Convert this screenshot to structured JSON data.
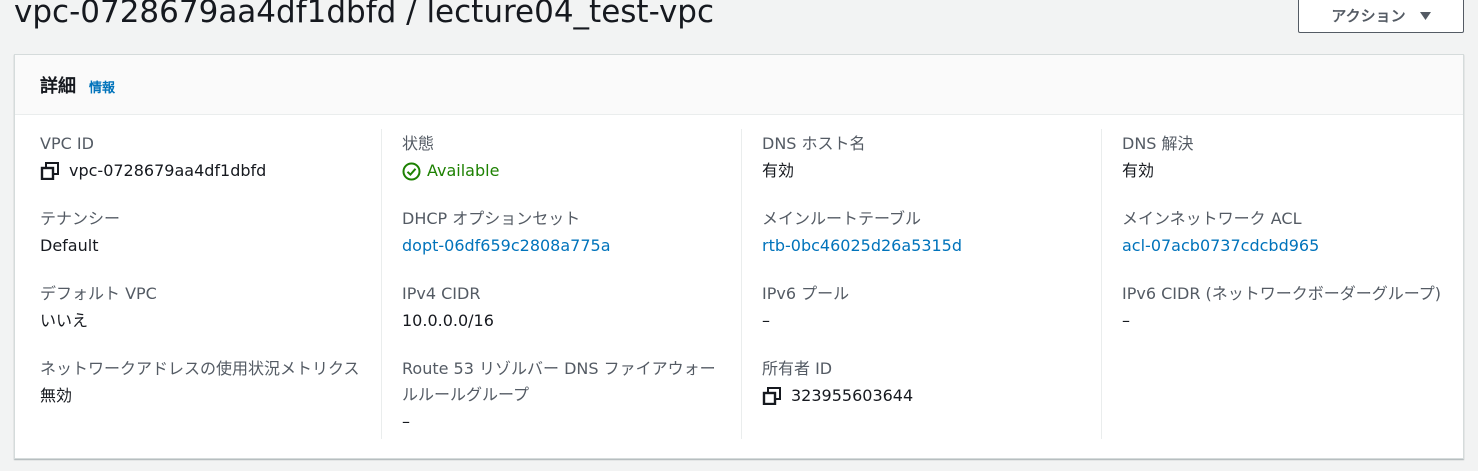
{
  "header": {
    "title": "vpc-0728679aa4df1dbfd / lecture04_test-vpc",
    "actions_label": "アクション"
  },
  "details": {
    "title": "詳細",
    "info_label": "情報"
  },
  "fields": {
    "vpc_id": {
      "label": "VPC ID",
      "value": "vpc-0728679aa4df1dbfd"
    },
    "state": {
      "label": "状態",
      "value": "Available"
    },
    "dns_hostnames": {
      "label": "DNS ホスト名",
      "value": "有効"
    },
    "dns_resolution": {
      "label": "DNS 解決",
      "value": "有効"
    },
    "tenancy": {
      "label": "テナンシー",
      "value": "Default"
    },
    "dhcp_options": {
      "label": "DHCP オプションセット",
      "value": "dopt-06df659c2808a775a"
    },
    "main_route_table": {
      "label": "メインルートテーブル",
      "value": "rtb-0bc46025d26a5315d"
    },
    "main_network_acl": {
      "label": "メインネットワーク ACL",
      "value": "acl-07acb0737cdcbd965"
    },
    "default_vpc": {
      "label": "デフォルト VPC",
      "value": "いいえ"
    },
    "ipv4_cidr": {
      "label": "IPv4 CIDR",
      "value": "10.0.0.0/16"
    },
    "ipv6_pool": {
      "label": "IPv6 プール",
      "value": "–"
    },
    "ipv6_cidr": {
      "label": "IPv6 CIDR (ネットワークボーダーグループ)",
      "value": "–"
    },
    "network_address_usage": {
      "label": "ネットワークアドレスの使用状況メトリクス",
      "value": "無効"
    },
    "route53_resolver": {
      "label": "Route 53 リゾルバー DNS ファイアウォールルールグループ",
      "value": "–"
    },
    "owner_id": {
      "label": "所有者 ID",
      "value": "323955603644"
    }
  },
  "colors": {
    "link": "#0073bb",
    "success": "#1d8102",
    "label": "#545b64",
    "text": "#16191f"
  },
  "icons": {
    "copy": "copy-icon",
    "status": "check-circle-icon",
    "caret": "caret-down-icon"
  }
}
